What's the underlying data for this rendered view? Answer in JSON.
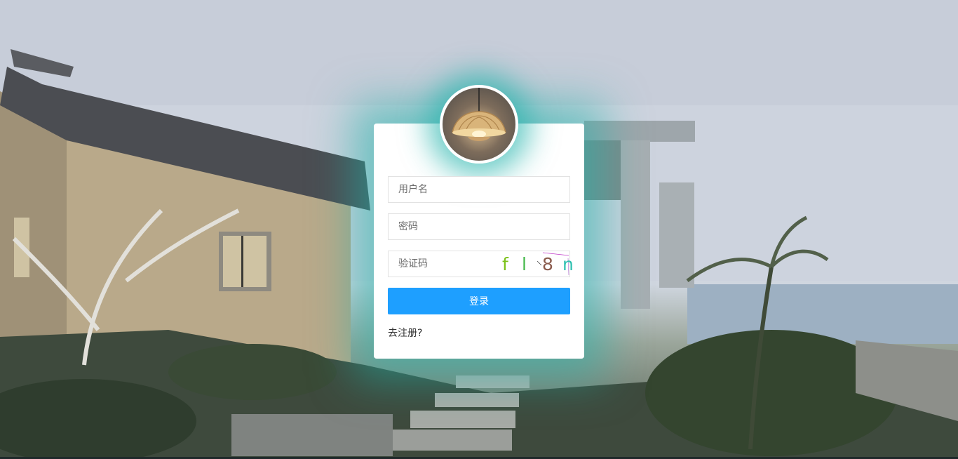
{
  "login": {
    "username_placeholder": "用户名",
    "password_placeholder": "密码",
    "captcha_placeholder": "验证码",
    "captcha_chars": [
      "f",
      "l",
      "8",
      "n"
    ],
    "captcha_colors": [
      "#7cc21a",
      "#44b84a",
      "#8a5a4c",
      "#2fc0b0"
    ],
    "submit_label": "登录",
    "register_link": "去注册?"
  },
  "colors": {
    "accent": "#1e9fff",
    "glow": "#20b2aa"
  },
  "icons": {
    "avatar": "pendant-lamp-avatar"
  }
}
